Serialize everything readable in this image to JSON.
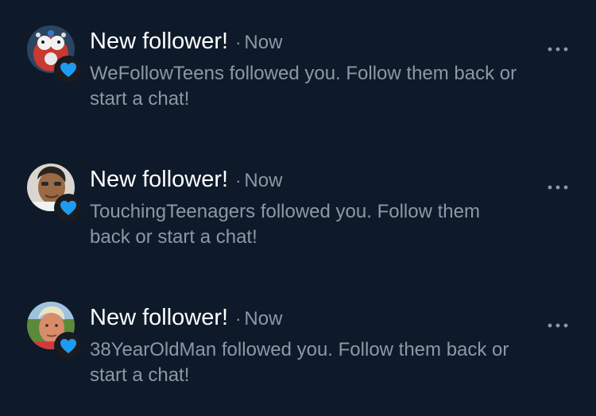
{
  "notifications": [
    {
      "title": "New follower!",
      "separator": "·",
      "time": "Now",
      "message": "WeFollowTeens followed you. Follow them back or start a chat!"
    },
    {
      "title": "New follower!",
      "separator": "·",
      "time": "Now",
      "message": "TouchingTeenagers followed you. Follow them back or start a chat!"
    },
    {
      "title": "New follower!",
      "separator": "·",
      "time": "Now",
      "message": "38YearOldMan followed you. Follow them back or start a chat!"
    }
  ],
  "icons": {
    "badge": "heart-icon",
    "menu": "more-options-icon"
  },
  "colors": {
    "background": "#0e1a2a",
    "title": "#ffffff",
    "secondary_text": "#8d98a5",
    "heart": "#1d9bf0"
  }
}
